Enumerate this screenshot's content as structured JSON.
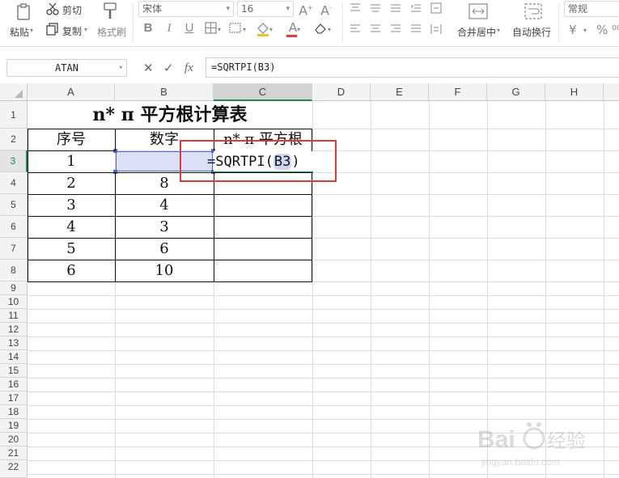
{
  "ribbon": {
    "paste": "粘贴",
    "cut": "剪切",
    "copy": "复制",
    "format_painter": "格式刷",
    "font_name": "宋体",
    "font_size": "16",
    "bold": "B",
    "italic": "I",
    "underline": "U",
    "font_color_glyph": "A",
    "merge_center": "合并居中",
    "wrap_text": "自动换行",
    "number_format": "常规",
    "currency": "¥",
    "percent": "%"
  },
  "formula_bar": {
    "name_box": "ATAN",
    "fx_label": "fx",
    "formula": "=SQRTPI(B3)"
  },
  "columns": [
    "A",
    "B",
    "C",
    "D",
    "E",
    "F",
    "G",
    "H"
  ],
  "rows": [
    "1",
    "2",
    "3",
    "4",
    "5",
    "6",
    "7",
    "8",
    "9",
    "10",
    "11",
    "12",
    "13",
    "14",
    "15",
    "16",
    "17",
    "18",
    "19",
    "20",
    "21",
    "22"
  ],
  "sheet": {
    "title": "n* π 平方根计算表",
    "headers": [
      "序号",
      "数字",
      "n* π 平方根"
    ],
    "edit_prefix": "=SQRTPI(",
    "edit_ref": "B3",
    "edit_suffix": ")",
    "data": [
      {
        "seq": "1",
        "num": ""
      },
      {
        "seq": "2",
        "num": "8"
      },
      {
        "seq": "3",
        "num": "4"
      },
      {
        "seq": "4",
        "num": "3"
      },
      {
        "seq": "5",
        "num": "6"
      },
      {
        "seq": "6",
        "num": "10"
      }
    ]
  },
  "colors": {
    "accent": "#1f8a4c",
    "highlight_box": "#e0383c",
    "ref_fill": "#dbe0f7"
  }
}
